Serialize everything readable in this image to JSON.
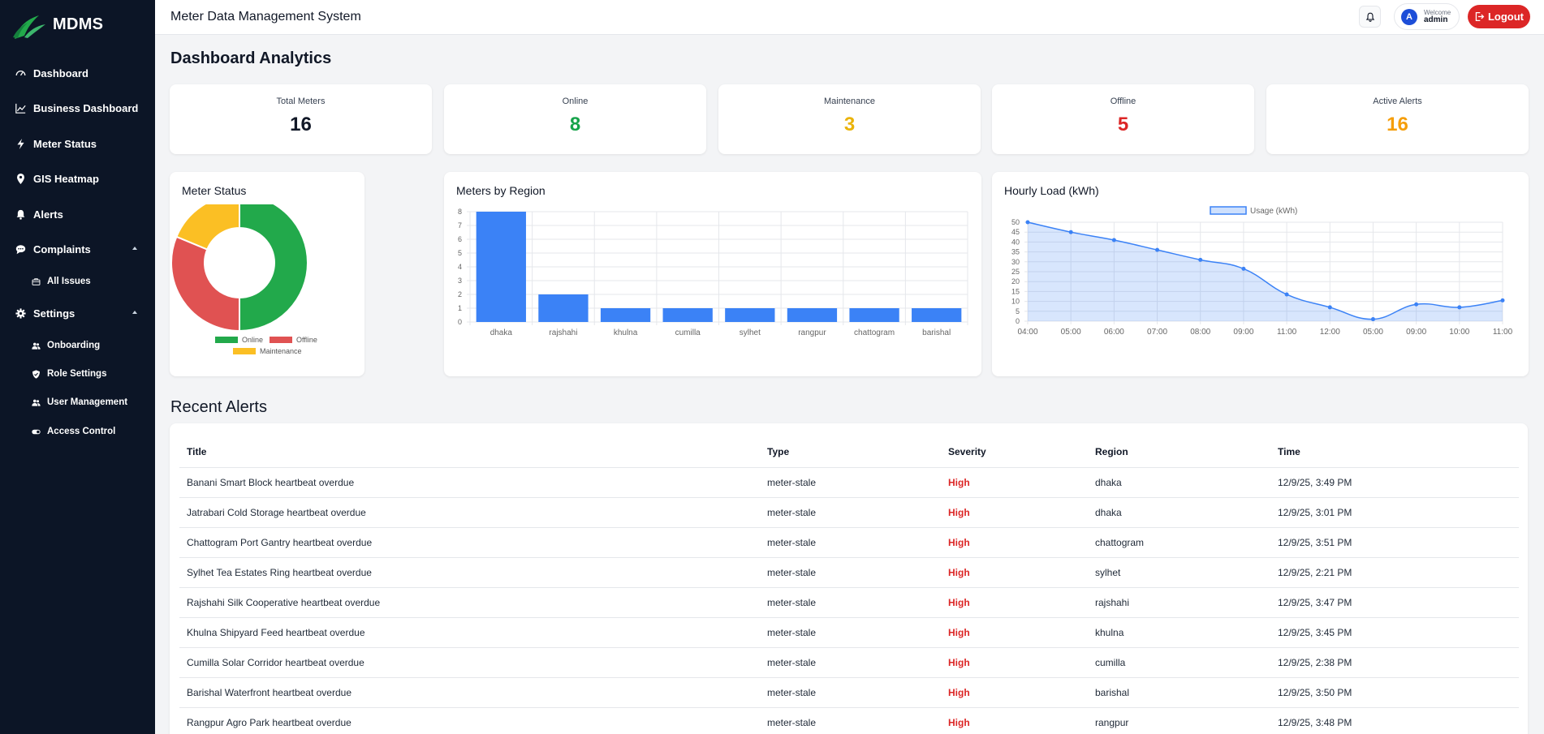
{
  "app": {
    "brand": "MDMS",
    "title": "Meter Data Management System"
  },
  "topbar": {
    "welcome_label": "Welcome",
    "user_name": "admin",
    "avatar_initial": "A",
    "logout_label": "Logout"
  },
  "sidebar": {
    "items": [
      {
        "label": "Dashboard",
        "icon": "dashboard-icon"
      },
      {
        "label": "Business Dashboard",
        "icon": "chart-line-icon"
      },
      {
        "label": "Meter Status",
        "icon": "bolt-icon"
      },
      {
        "label": "GIS Heatmap",
        "icon": "map-pin-icon"
      },
      {
        "label": "Alerts",
        "icon": "bell-icon"
      },
      {
        "label": "Complaints",
        "icon": "chat-icon"
      },
      {
        "label": "Settings",
        "icon": "gear-icon"
      }
    ],
    "complaints_sub": [
      {
        "label": "All Issues",
        "icon": "briefcase-icon"
      }
    ],
    "settings_sub": [
      {
        "label": "Onboarding",
        "icon": "users-icon"
      },
      {
        "label": "Role Settings",
        "icon": "shield-icon"
      },
      {
        "label": "User Management",
        "icon": "users-icon"
      },
      {
        "label": "Access Control",
        "icon": "toggle-icon"
      }
    ]
  },
  "dashboard": {
    "title": "Dashboard Analytics",
    "stats": [
      {
        "label": "Total Meters",
        "value": "16",
        "color": "#111827"
      },
      {
        "label": "Online",
        "value": "8",
        "color": "#16a34a"
      },
      {
        "label": "Maintenance",
        "value": "3",
        "color": "#eab308"
      },
      {
        "label": "Offline",
        "value": "5",
        "color": "#dc2626"
      },
      {
        "label": "Active Alerts",
        "value": "16",
        "color": "#f59e0b"
      }
    ]
  },
  "chart_data": [
    {
      "type": "pie",
      "title": "Meter Status",
      "donut": true,
      "categories": [
        "Online",
        "Offline",
        "Maintenance"
      ],
      "values": [
        8,
        5,
        3
      ],
      "colors": [
        "#22a94b",
        "#e05252",
        "#fbbf24"
      ],
      "legend": "bottom"
    },
    {
      "type": "bar",
      "title": "Meters by Region",
      "categories": [
        "dhaka",
        "rajshahi",
        "khulna",
        "cumilla",
        "sylhet",
        "rangpur",
        "chattogram",
        "barishal"
      ],
      "values": [
        8,
        2,
        1,
        1,
        1,
        1,
        1,
        1
      ],
      "ylim": [
        0,
        8
      ],
      "yticks": [
        "0",
        "1",
        "2",
        "3",
        "4",
        "5",
        "6",
        "7",
        "8"
      ],
      "color": "#3b82f6",
      "grid": true
    },
    {
      "type": "area",
      "title": "Hourly Load (kWh)",
      "categories": [
        "04:00",
        "05:00",
        "06:00",
        "07:00",
        "08:00",
        "09:00",
        "11:00",
        "12:00",
        "05:00",
        "09:00",
        "10:00",
        "11:00"
      ],
      "series": [
        {
          "name": "Usage (kWh)",
          "values": [
            50,
            45,
            41,
            36,
            31,
            26.5,
            13.5,
            7,
            1,
            8.5,
            7,
            10.5
          ]
        }
      ],
      "ylim": [
        0,
        50
      ],
      "yticks": [
        "0",
        "5",
        "10",
        "15",
        "20",
        "25",
        "30",
        "35",
        "40",
        "45",
        "50"
      ],
      "color": "#3b82f6",
      "legend": "top",
      "grid": true
    }
  ],
  "alerts": {
    "title": "Recent Alerts",
    "columns": [
      "Title",
      "Type",
      "Severity",
      "Region",
      "Time"
    ],
    "rows": [
      [
        "Banani Smart Block heartbeat overdue",
        "meter-stale",
        "High",
        "dhaka",
        "12/9/25, 3:49 PM"
      ],
      [
        "Jatrabari Cold Storage heartbeat overdue",
        "meter-stale",
        "High",
        "dhaka",
        "12/9/25, 3:01 PM"
      ],
      [
        "Chattogram Port Gantry heartbeat overdue",
        "meter-stale",
        "High",
        "chattogram",
        "12/9/25, 3:51 PM"
      ],
      [
        "Sylhet Tea Estates Ring heartbeat overdue",
        "meter-stale",
        "High",
        "sylhet",
        "12/9/25, 2:21 PM"
      ],
      [
        "Rajshahi Silk Cooperative heartbeat overdue",
        "meter-stale",
        "High",
        "rajshahi",
        "12/9/25, 3:47 PM"
      ],
      [
        "Khulna Shipyard Feed heartbeat overdue",
        "meter-stale",
        "High",
        "khulna",
        "12/9/25, 3:45 PM"
      ],
      [
        "Cumilla Solar Corridor heartbeat overdue",
        "meter-stale",
        "High",
        "cumilla",
        "12/9/25, 2:38 PM"
      ],
      [
        "Barishal Waterfront heartbeat overdue",
        "meter-stale",
        "High",
        "barishal",
        "12/9/25, 3:50 PM"
      ],
      [
        "Rangpur Agro Park heartbeat overdue",
        "meter-stale",
        "High",
        "rangpur",
        "12/9/25, 3:48 PM"
      ]
    ]
  }
}
